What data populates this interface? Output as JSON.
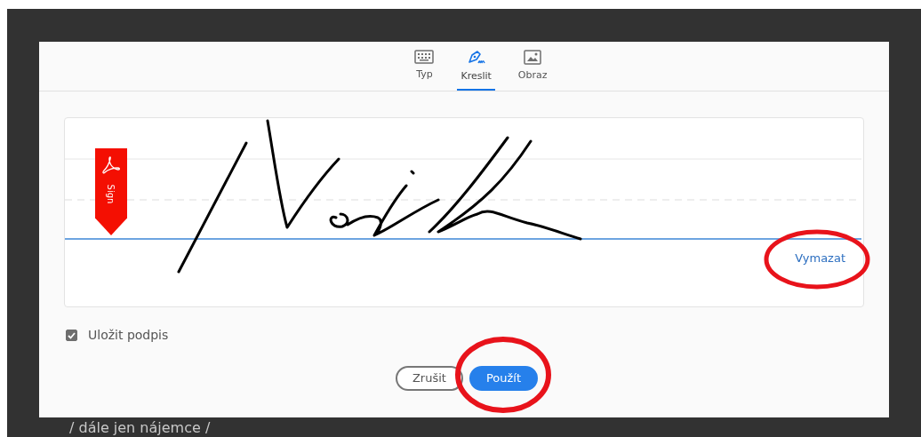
{
  "tabs": [
    {
      "label": "Typ",
      "kind": "keyboard",
      "selected": false
    },
    {
      "label": "Kreslit",
      "kind": "pen",
      "selected": true
    },
    {
      "label": "Obraz",
      "kind": "image",
      "selected": false
    }
  ],
  "signature_pad": {
    "badge": "Sign",
    "clear_link": "Vymazat"
  },
  "save_signature": {
    "label": "Uložit podpis",
    "checked": true
  },
  "buttons": [
    {
      "label": "Zrušit",
      "kind": "secondary"
    },
    {
      "label": "Použít",
      "kind": "primary"
    }
  ],
  "background_text": "/ dále jen nájemce /"
}
